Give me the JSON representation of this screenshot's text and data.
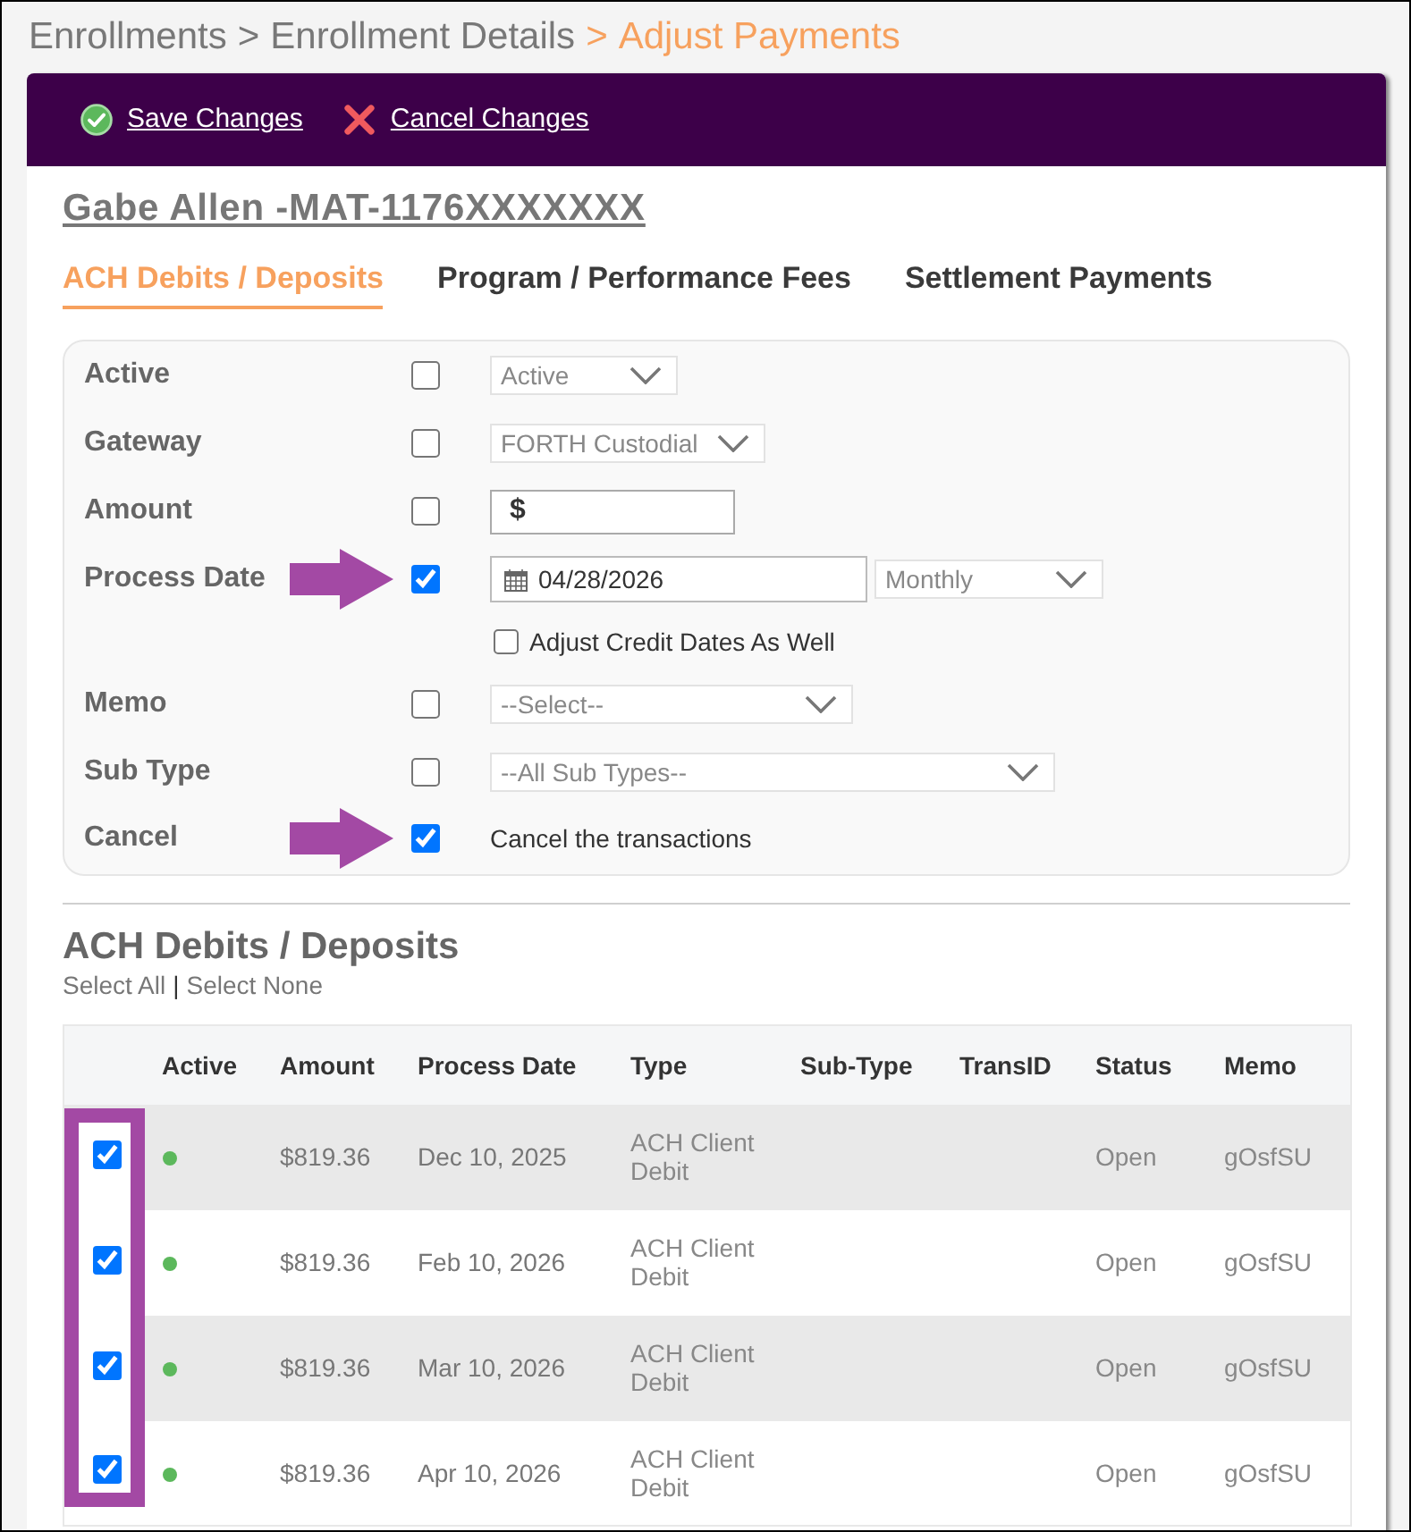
{
  "breadcrumb": {
    "separator": ">",
    "items": [
      {
        "label": "Enrollments",
        "current": false
      },
      {
        "label": "Enrollment Details",
        "current": false
      },
      {
        "label": "Adjust Payments",
        "current": true
      }
    ]
  },
  "toolbar": [
    {
      "kind": "save",
      "label": "Save Changes"
    },
    {
      "kind": "cancel",
      "label": "Cancel Changes"
    }
  ],
  "record_title": "Gabe Allen -MAT-1176XXXXXXX",
  "tabs": [
    {
      "label": "ACH Debits / Deposits",
      "selected": true
    },
    {
      "label": "Program / Performance Fees",
      "selected": false
    },
    {
      "label": "Settlement Payments",
      "selected": false
    }
  ],
  "filters": [
    {
      "label": "Active",
      "checked": false,
      "pointed": false,
      "kind": "select",
      "value": "Active"
    },
    {
      "label": "Gateway",
      "checked": false,
      "pointed": false,
      "kind": "select",
      "value": "FORTH Custodial"
    },
    {
      "label": "Amount",
      "checked": false,
      "pointed": false,
      "kind": "amount",
      "value": "$"
    },
    {
      "label": "Process Date",
      "checked": true,
      "pointed": true,
      "kind": "date",
      "value": "04/28/2026",
      "frequency": "Monthly",
      "option": {
        "label": "Adjust Credit Dates As Well",
        "checked": false
      }
    },
    {
      "label": "Memo",
      "checked": false,
      "pointed": false,
      "kind": "select",
      "value": "--Select--"
    },
    {
      "label": "Sub Type",
      "checked": false,
      "pointed": false,
      "kind": "select",
      "value": "--All Sub Types--"
    },
    {
      "label": "Cancel",
      "checked": true,
      "pointed": true,
      "kind": "note",
      "value": "Cancel the transactions"
    }
  ],
  "section": {
    "title": "ACH Debits / Deposits",
    "separator": "|",
    "links": [
      {
        "label": "Select All"
      },
      {
        "label": "Select None"
      }
    ]
  },
  "table": {
    "checkbox_highlight": true,
    "columns": [
      "Active",
      "Amount",
      "Process Date",
      "Type",
      "Sub-Type",
      "TransID",
      "Status",
      "Memo"
    ],
    "rows": [
      {
        "selected": true,
        "active": true,
        "amount": "$819.36",
        "process_date": "Dec 10, 2025",
        "type": "ACH Client Debit",
        "status": "Open",
        "memo": "gOsfSU"
      },
      {
        "selected": true,
        "active": true,
        "amount": "$819.36",
        "process_date": "Feb 10, 2026",
        "type": "ACH Client Debit",
        "status": "Open",
        "memo": "gOsfSU"
      },
      {
        "selected": true,
        "active": true,
        "amount": "$819.36",
        "process_date": "Mar 10, 2026",
        "type": "ACH Client Debit",
        "status": "Open",
        "memo": "gOsfSU"
      },
      {
        "selected": true,
        "active": true,
        "amount": "$819.36",
        "process_date": "Apr 10, 2026",
        "type": "ACH Client Debit",
        "status": "Open",
        "memo": "gOsfSU"
      }
    ]
  }
}
